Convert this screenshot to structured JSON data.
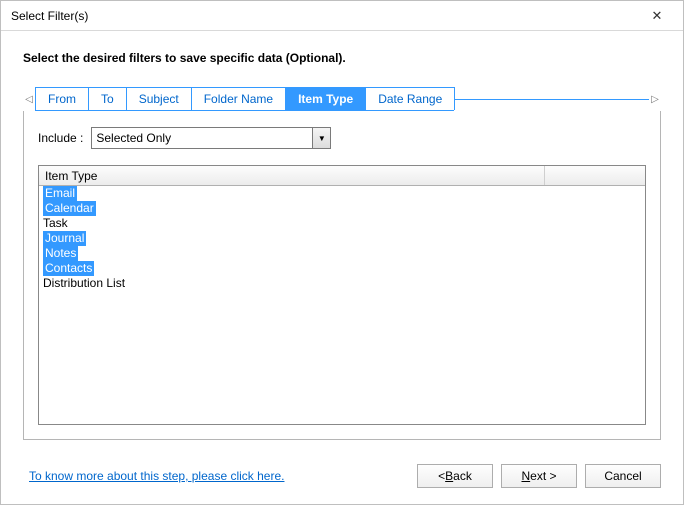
{
  "window": {
    "title": "Select Filter(s)"
  },
  "instruction": "Select the desired filters to save specific data (Optional).",
  "tabs": [
    {
      "label": "From",
      "active": false
    },
    {
      "label": "To",
      "active": false
    },
    {
      "label": "Subject",
      "active": false
    },
    {
      "label": "Folder Name",
      "active": false
    },
    {
      "label": "Item Type",
      "active": true
    },
    {
      "label": "Date Range",
      "active": false
    }
  ],
  "include": {
    "label": "Include :",
    "value": "Selected Only"
  },
  "list": {
    "header": "Item Type",
    "items": [
      {
        "label": "Email",
        "selected": true
      },
      {
        "label": "Calendar",
        "selected": true
      },
      {
        "label": "Task",
        "selected": false
      },
      {
        "label": "Journal",
        "selected": true
      },
      {
        "label": "Notes",
        "selected": true
      },
      {
        "label": "Contacts",
        "selected": true
      },
      {
        "label": "Distribution List",
        "selected": false
      }
    ]
  },
  "help_link": "To know more about this step, please click here.",
  "buttons": {
    "back": "< Back",
    "next": "Next >",
    "cancel": "Cancel"
  }
}
